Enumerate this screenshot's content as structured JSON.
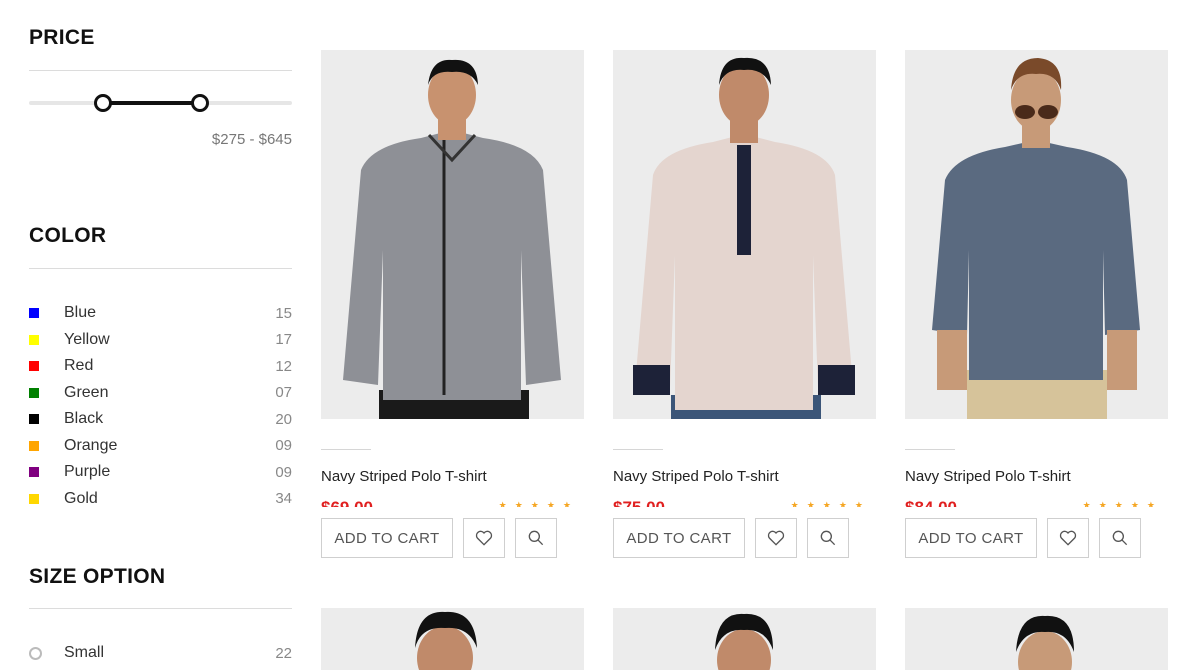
{
  "filters": {
    "price": {
      "title": "PRICE",
      "range_text": "$275 - $645",
      "min_fraction": 0.28,
      "max_fraction": 0.65
    },
    "color": {
      "title": "COLOR",
      "items": [
        {
          "label": "Blue",
          "count": "15",
          "swatch": "#0000ff"
        },
        {
          "label": "Yellow",
          "count": "17",
          "swatch": "#ffff00"
        },
        {
          "label": "Red",
          "count": "12",
          "swatch": "#ff0000"
        },
        {
          "label": "Green",
          "count": "07",
          "swatch": "#008000"
        },
        {
          "label": "Black",
          "count": "20",
          "swatch": "#000000"
        },
        {
          "label": "Orange",
          "count": "09",
          "swatch": "#ffa500"
        },
        {
          "label": "Purple",
          "count": "09",
          "swatch": "#800080"
        },
        {
          "label": "Gold",
          "count": "34",
          "swatch": "#ffd700"
        }
      ]
    },
    "size": {
      "title": "SIZE OPTION",
      "items": [
        {
          "label": "Small",
          "count": "22"
        }
      ]
    }
  },
  "products": [
    {
      "title": "Navy Striped Polo T-shirt",
      "price": "$69.00",
      "rating": 5,
      "shirt_color": "#8e9096",
      "image_icon": "grey-shirt-model-photo"
    },
    {
      "title": "Navy Striped Polo T-shirt",
      "price": "$75.00",
      "rating": 5,
      "shirt_color": "#e4d5cf",
      "image_icon": "pink-shirt-model-photo"
    },
    {
      "title": "Navy Striped Polo T-shirt",
      "price": "$84.00",
      "rating": 5,
      "shirt_color": "#5a6a80",
      "image_icon": "denim-shirt-model-photo"
    }
  ],
  "actions": {
    "add_to_cart": "ADD TO CART",
    "wishlist_icon": "heart-icon",
    "quickview_icon": "search-icon"
  },
  "colors": {
    "price": "#e02020",
    "star": "#f5a623",
    "border": "#cfcfcf"
  }
}
